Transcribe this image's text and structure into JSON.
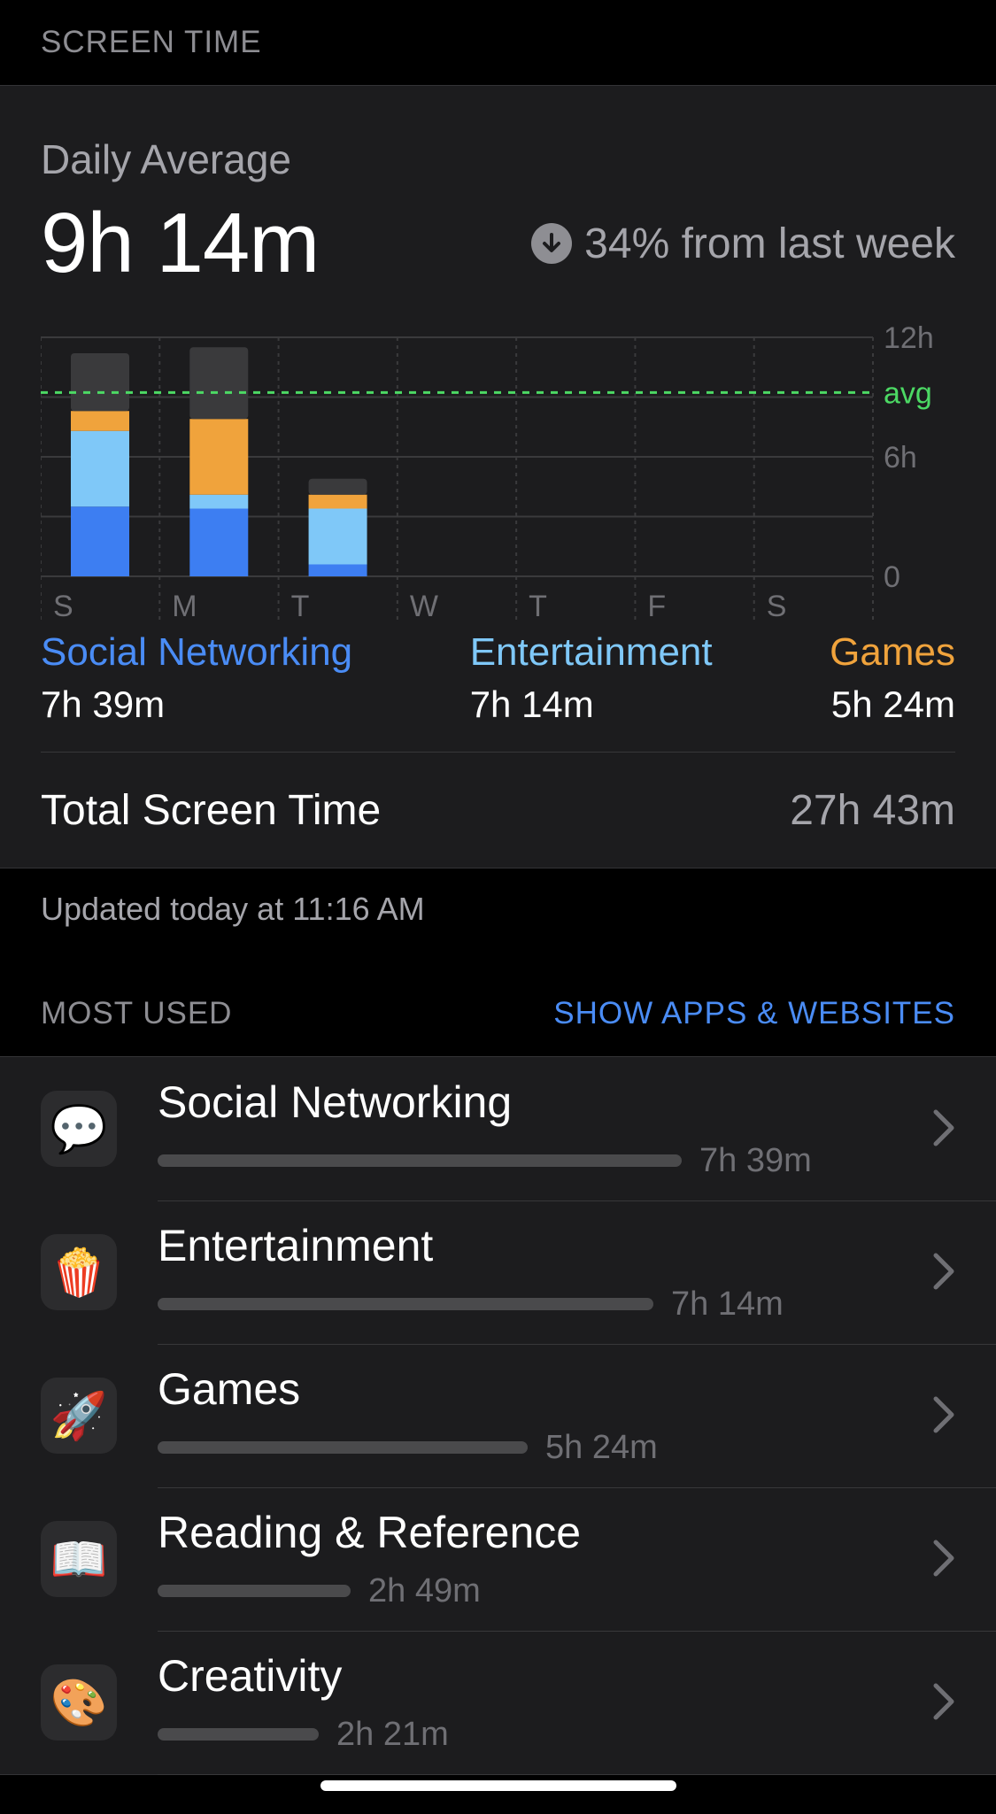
{
  "header": {
    "title": "SCREEN TIME"
  },
  "summary": {
    "daily_label": "Daily Average",
    "daily_value": "9h 14m",
    "trend_text": "34% from last week",
    "trend_icon": "arrow-down-circle-icon"
  },
  "chart_data": {
    "type": "bar",
    "stacked": true,
    "categories": [
      "S",
      "M",
      "T",
      "W",
      "T",
      "F",
      "S"
    ],
    "y_ticks": [
      "12h",
      "avg",
      "6h",
      "0"
    ],
    "ylim": [
      0,
      12
    ],
    "avg_hours": 9.23,
    "series": [
      {
        "name": "Social Networking",
        "color": "#3d7ef2",
        "values": [
          3.5,
          3.4,
          0.6,
          0,
          0,
          0,
          0
        ]
      },
      {
        "name": "Entertainment",
        "color": "#7fc8f8",
        "values": [
          3.8,
          0.7,
          2.8,
          0,
          0,
          0,
          0
        ]
      },
      {
        "name": "Games",
        "color": "#f0a33c",
        "values": [
          1.0,
          3.8,
          0.7,
          0,
          0,
          0,
          0
        ]
      },
      {
        "name": "",
        "color": "#3a3a3c",
        "values": [
          2.9,
          3.6,
          0.8,
          0,
          0,
          0,
          0
        ]
      }
    ],
    "grid": true,
    "avg_color": "#4cd964"
  },
  "categories_summary": [
    {
      "name": "Social Networking",
      "value": "7h 39m",
      "color": "#4a8cf5"
    },
    {
      "name": "Entertainment",
      "value": "7h 14m",
      "color": "#7fc8f8"
    },
    {
      "name": "Games",
      "value": "5h 24m",
      "color": "#f0a33c"
    }
  ],
  "total": {
    "label": "Total Screen Time",
    "value": "27h 43m"
  },
  "updated_text": "Updated today at 11:16 AM",
  "most_used": {
    "title": "MOST USED",
    "link": "SHOW APPS & WEBSITES",
    "items": [
      {
        "name": "Social Networking",
        "time": "7h 39m",
        "fraction": 1.0,
        "icon": "speech-bubbles-heart-icon",
        "glyph": "💬"
      },
      {
        "name": "Entertainment",
        "time": "7h 14m",
        "fraction": 0.946,
        "icon": "popcorn-icon",
        "glyph": "🍿"
      },
      {
        "name": "Games",
        "time": "5h 24m",
        "fraction": 0.706,
        "icon": "rocket-icon",
        "glyph": "🚀"
      },
      {
        "name": "Reading & Reference",
        "time": "2h 49m",
        "fraction": 0.368,
        "icon": "open-book-icon",
        "glyph": "📖"
      },
      {
        "name": "Creativity",
        "time": "2h 21m",
        "fraction": 0.307,
        "icon": "palette-icon",
        "glyph": "🎨"
      }
    ]
  }
}
